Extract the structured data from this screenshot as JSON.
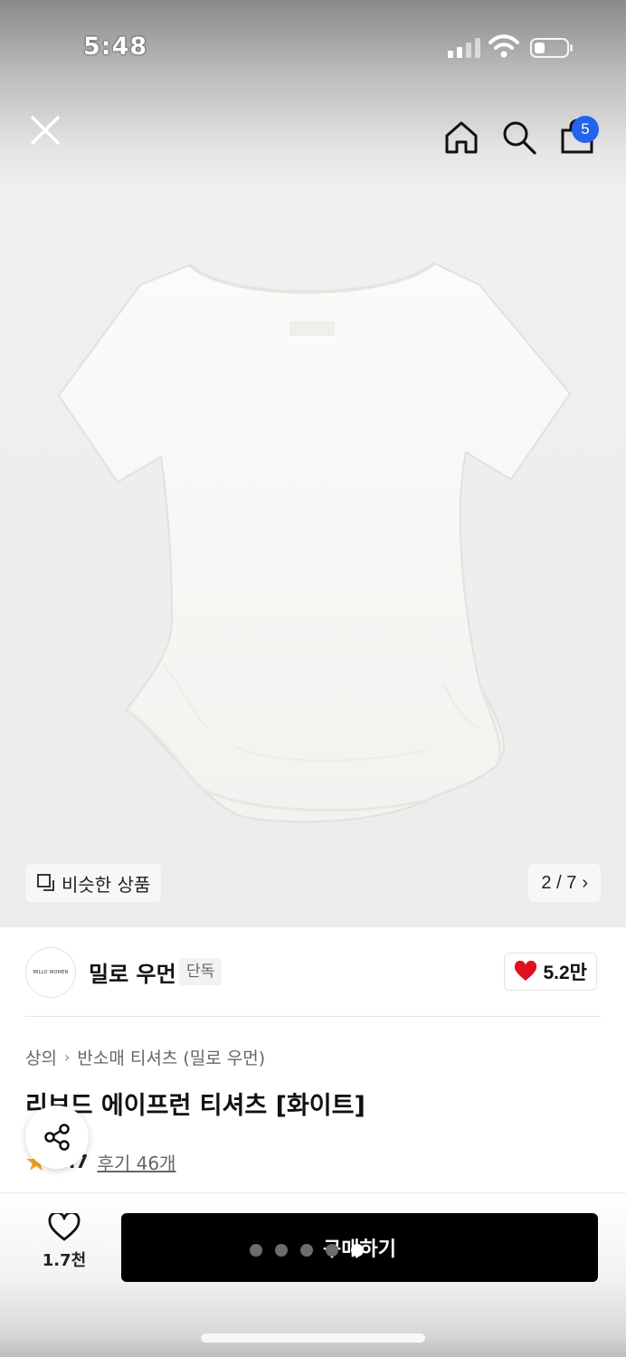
{
  "status_bar": {
    "time": "5:48"
  },
  "nav": {
    "close_icon": "close-icon",
    "home_icon": "home-icon",
    "search_icon": "search-icon",
    "cart_icon": "shopping-bag-icon",
    "cart_badge": "5",
    "badge_color": "#2463eb"
  },
  "gallery": {
    "similar_label": "비슷한 상품",
    "pager": "2 / 7",
    "pager_chevron": "›"
  },
  "brand": {
    "logo_text": "MILLO WOMEN",
    "name": "밀로 우먼",
    "tag": "단독",
    "likes": "5.2만",
    "heart_color": "#e0101c"
  },
  "breadcrumb": {
    "level1": "상의",
    "separator": "›",
    "level2": "반소매 티셔츠 (밀로 우먼)"
  },
  "product": {
    "title": "리브드 에이프런 티셔츠 [화이트]",
    "rating": "4.7",
    "review_link": "후기 46개",
    "star_color": "#f5a623"
  },
  "bottom_bar": {
    "wish_count": "1.7천",
    "buy_label": "구매하기",
    "buy_color": "#000000"
  }
}
